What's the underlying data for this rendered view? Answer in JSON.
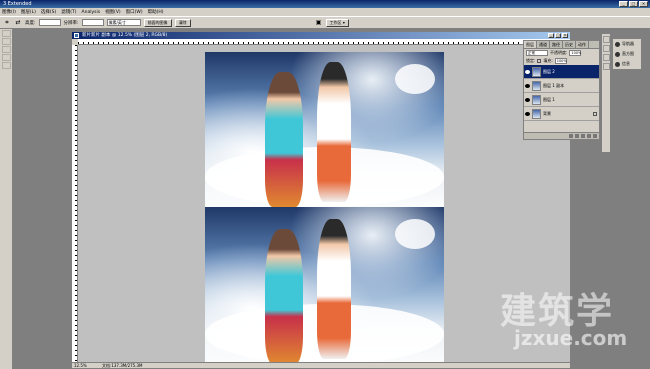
{
  "app": {
    "title": "3 Extended",
    "window_buttons": [
      "_",
      "□",
      "×"
    ]
  },
  "menu": [
    "图像(I)",
    "图层(L)",
    "选择(S)",
    "滤镜(T)",
    "Analysis",
    "视图(V)",
    "窗口(W)",
    "帮助(H)"
  ],
  "options": {
    "height_label": "高度:",
    "resolution_label": "分辨率:",
    "unit_select": "像素/英寸",
    "front_image_button": "前面的图像",
    "clear_button": "清除",
    "workspace_button": "工作区 ▾"
  },
  "document": {
    "title": "新片新片 副本 @ 12.5% (图层 2, RGB/8)",
    "buttons": [
      "_",
      "□",
      "×"
    ],
    "status": [
      "12.5%",
      "文档:137.3M/275.3M"
    ]
  },
  "layers_panel": {
    "tabs": [
      "图层",
      "通道",
      "路径",
      "历史",
      "动作"
    ],
    "blend_mode": "正常",
    "opacity_label": "不透明度:",
    "opacity_value": "100%",
    "lock_label": "锁定:",
    "fill_label": "填充:",
    "fill_value": "100%",
    "layers": [
      {
        "name": "图层 2",
        "active": true
      },
      {
        "name": "图层 1 副本",
        "active": false
      },
      {
        "name": "图层 1",
        "active": false
      },
      {
        "name": "背景",
        "active": false
      }
    ]
  },
  "nav_panel": {
    "items": [
      "导航器",
      "直方图",
      "信息"
    ]
  },
  "watermark": {
    "text": "建筑学",
    "url": "jzxue.com"
  }
}
